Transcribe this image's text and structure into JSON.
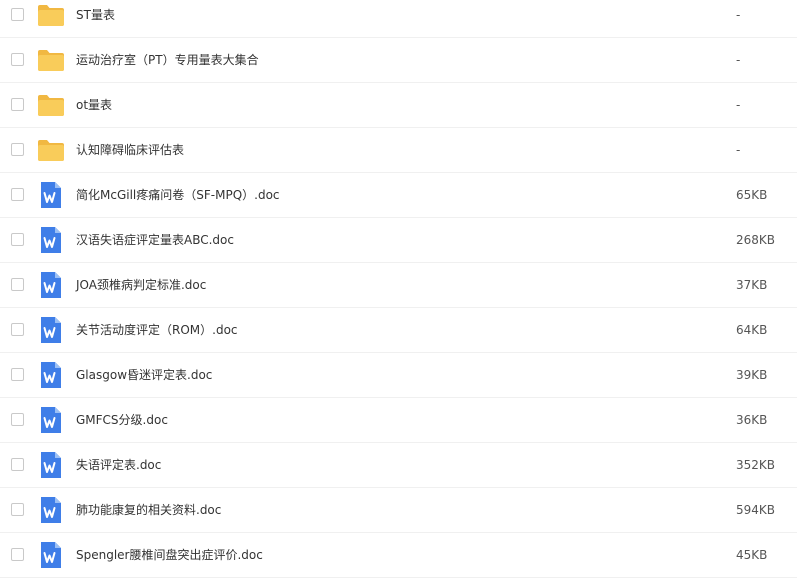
{
  "colors": {
    "folder": "#f9cc5a",
    "folder_tab": "#f1b842",
    "doc": "#3f7ee8",
    "doc_fold": "#9cc0f5"
  },
  "files": [
    {
      "name": "ST量表",
      "size": "-",
      "icon": "folder-icon"
    },
    {
      "name": "运动治疗室（PT）专用量表大集合",
      "size": "-",
      "icon": "folder-icon"
    },
    {
      "name": "ot量表",
      "size": "-",
      "icon": "folder-icon"
    },
    {
      "name": "认知障碍临床评估表",
      "size": "-",
      "icon": "folder-icon"
    },
    {
      "name": "简化McGill疼痛问卷（SF-MPQ）.doc",
      "size": "65KB",
      "icon": "word-doc-icon"
    },
    {
      "name": "汉语失语症评定量表ABC.doc",
      "size": "268KB",
      "icon": "word-doc-icon"
    },
    {
      "name": "JOA颈椎病判定标准.doc",
      "size": "37KB",
      "icon": "word-doc-icon"
    },
    {
      "name": "关节活动度评定（ROM）.doc",
      "size": "64KB",
      "icon": "word-doc-icon"
    },
    {
      "name": "Glasgow昏迷评定表.doc",
      "size": "39KB",
      "icon": "word-doc-icon"
    },
    {
      "name": "GMFCS分级.doc",
      "size": "36KB",
      "icon": "word-doc-icon"
    },
    {
      "name": "失语评定表.doc",
      "size": "352KB",
      "icon": "word-doc-icon"
    },
    {
      "name": "肺功能康复的相关资料.doc",
      "size": "594KB",
      "icon": "word-doc-icon"
    },
    {
      "name": "Spengler腰椎间盘突出症评价.doc",
      "size": "45KB",
      "icon": "word-doc-icon"
    }
  ]
}
